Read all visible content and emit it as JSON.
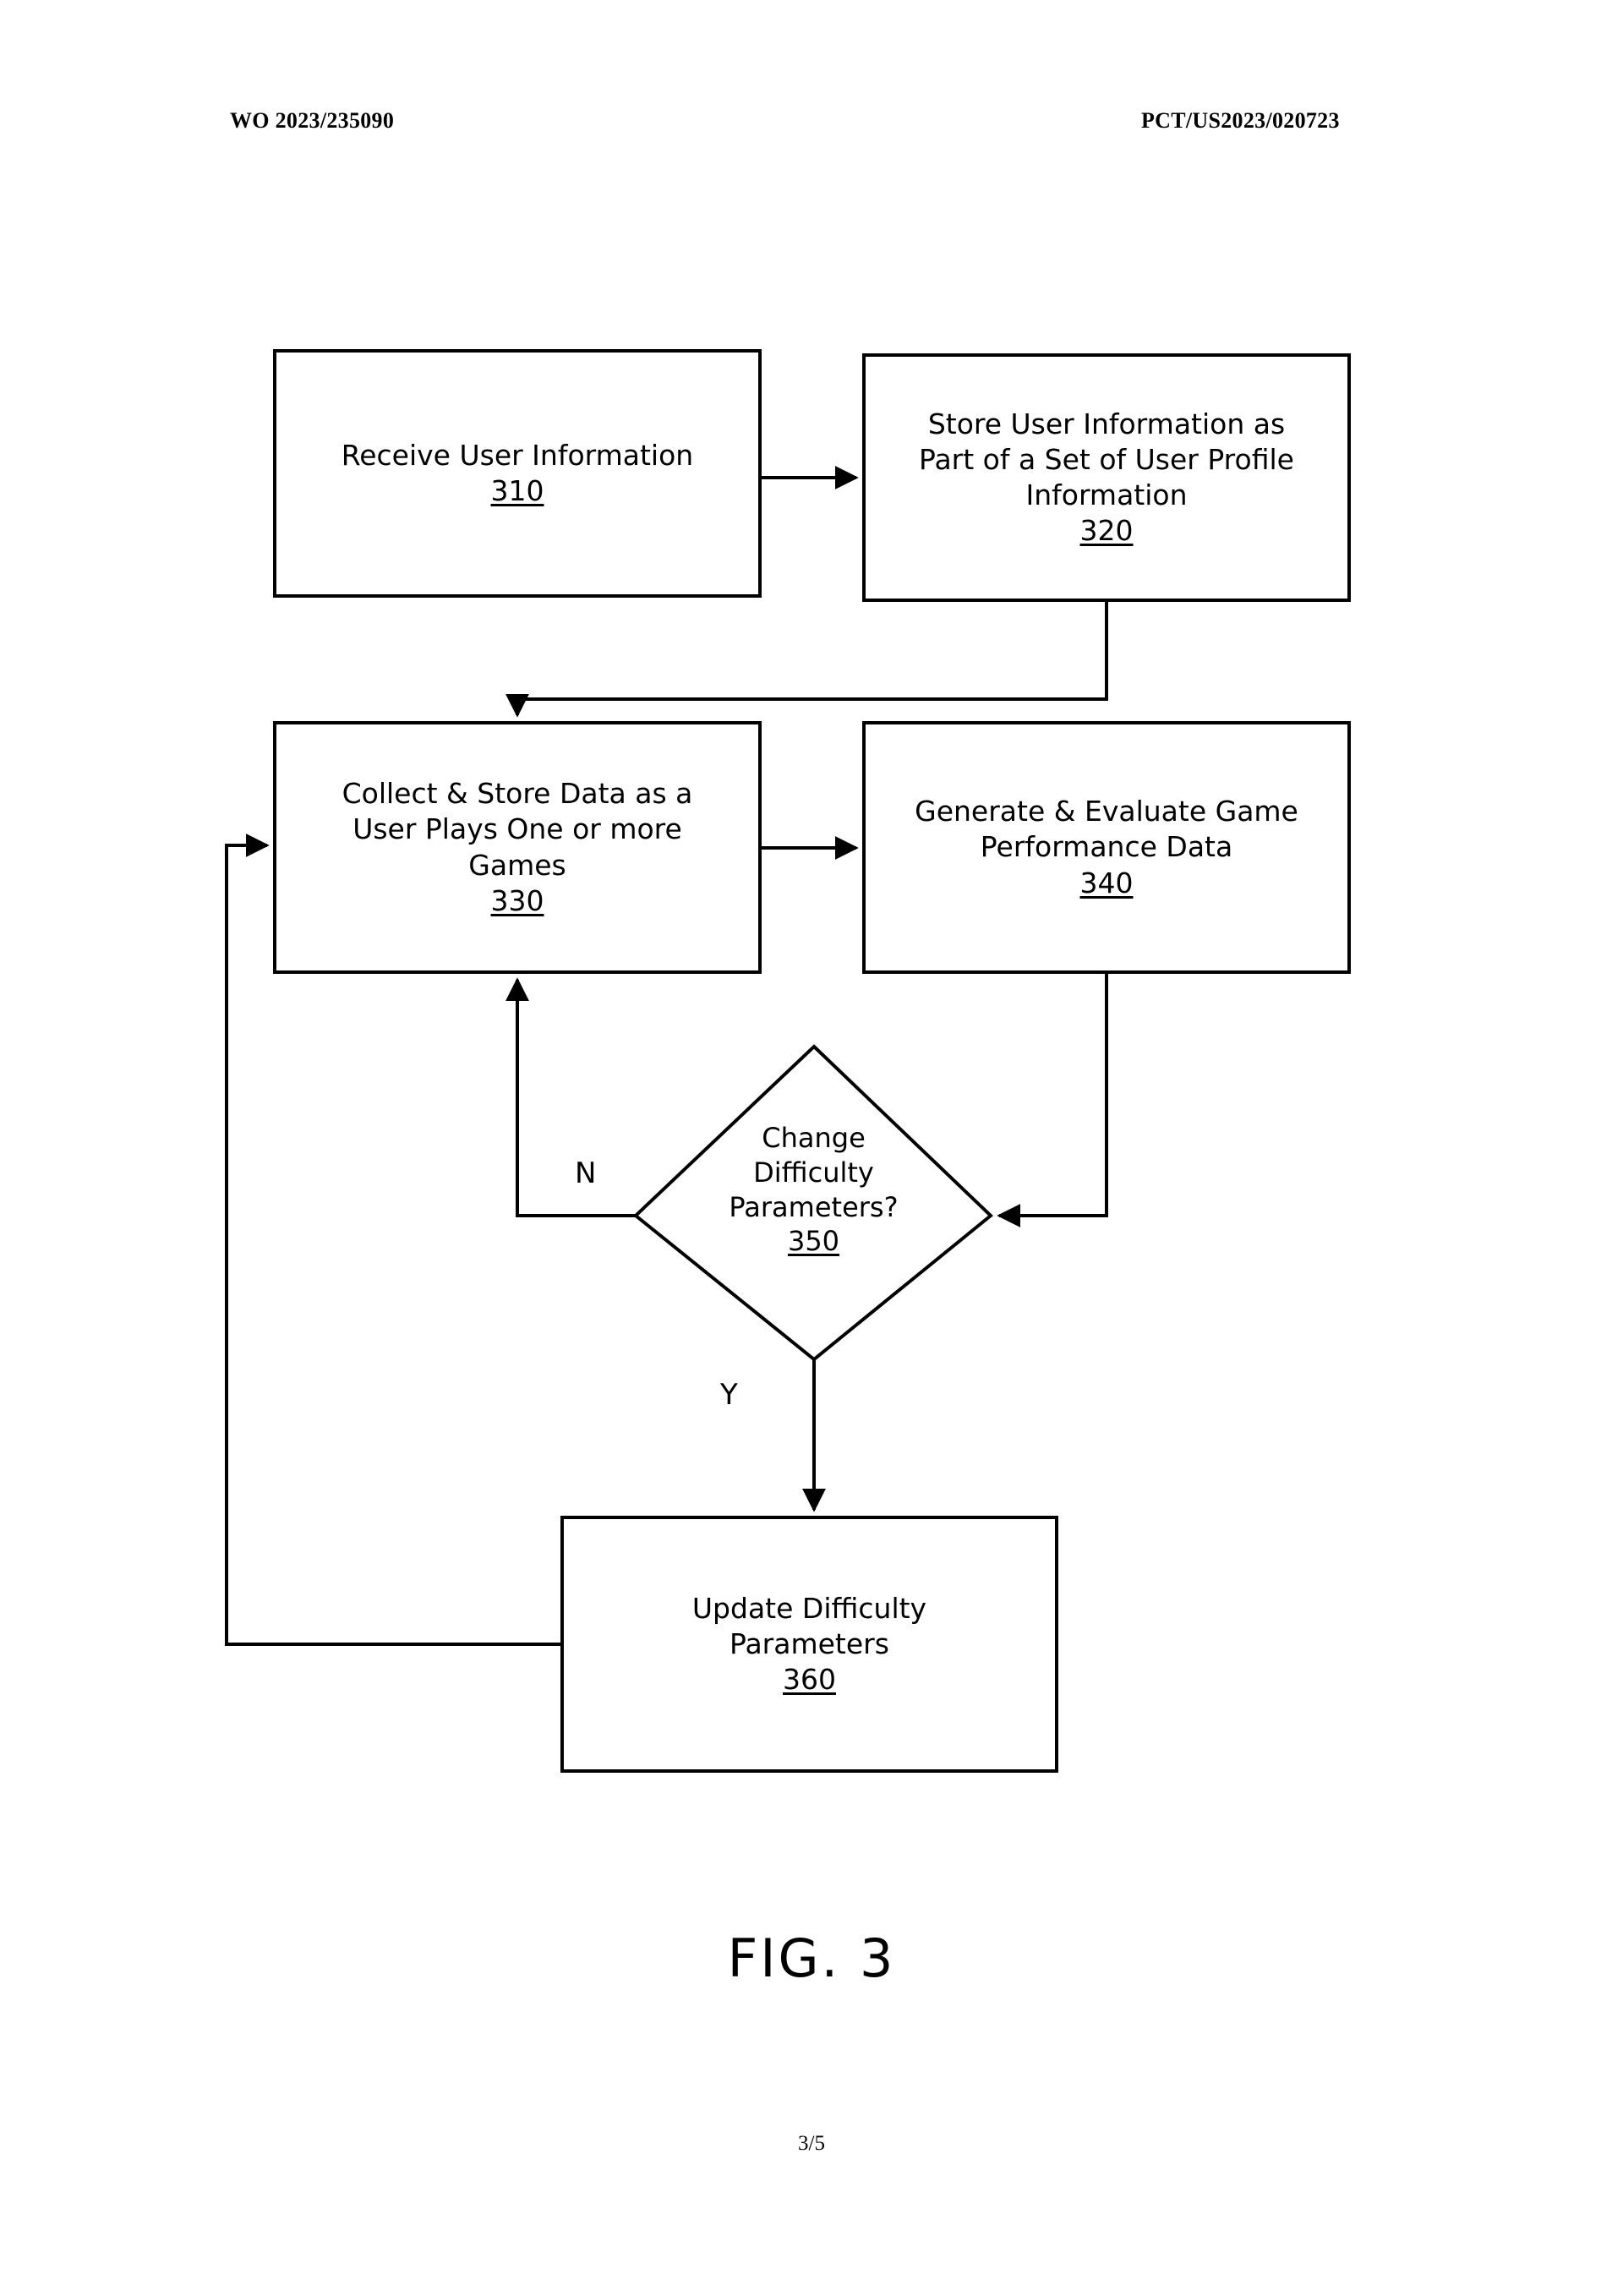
{
  "header": {
    "left": "WO 2023/235090",
    "right": "PCT/US2023/020723"
  },
  "figure": {
    "caption": "FIG. 3",
    "page_number": "3/5"
  },
  "chart_data": {
    "type": "diagram",
    "title": "FIG. 3",
    "nodes": [
      {
        "id": "310",
        "shape": "process",
        "label": "Receive User Information",
        "ref": "310",
        "lines": [
          "Receive User Information"
        ]
      },
      {
        "id": "320",
        "shape": "process",
        "label": "Store User Information as Part of a Set of User Profile Information",
        "ref": "320",
        "lines": [
          "Store User Information as",
          "Part of a Set of User Profile",
          "Information"
        ]
      },
      {
        "id": "330",
        "shape": "process",
        "label": "Collect & Store Data as a User Plays One or more Games",
        "ref": "330",
        "lines": [
          "Collect & Store Data as a",
          "User Plays One or more",
          "Games"
        ]
      },
      {
        "id": "340",
        "shape": "process",
        "label": "Generate & Evaluate Game Performance Data",
        "ref": "340",
        "lines": [
          "Generate & Evaluate Game",
          "Performance Data"
        ]
      },
      {
        "id": "350",
        "shape": "decision",
        "label": "Change Difficulty Parameters?",
        "ref": "350",
        "lines": [
          "Change",
          "Difficulty",
          "Parameters?"
        ]
      },
      {
        "id": "360",
        "shape": "process",
        "label": "Update Difficulty Parameters",
        "ref": "360",
        "lines": [
          "Update Difficulty",
          "Parameters"
        ]
      }
    ],
    "edges": [
      {
        "from": "310",
        "to": "320",
        "label": ""
      },
      {
        "from": "320",
        "to": "330",
        "label": ""
      },
      {
        "from": "330",
        "to": "340",
        "label": ""
      },
      {
        "from": "340",
        "to": "350",
        "label": ""
      },
      {
        "from": "350",
        "to": "330",
        "label": "N"
      },
      {
        "from": "350",
        "to": "360",
        "label": "Y"
      },
      {
        "from": "360",
        "to": "330",
        "label": ""
      }
    ],
    "branch_labels": {
      "no": "N",
      "yes": "Y"
    },
    "stroke_color": "#000000",
    "fill_color": "#ffffff"
  },
  "nodes": {
    "n310": {
      "l1": "Receive User Information",
      "ref": "310"
    },
    "n320": {
      "l1": "Store User Information as",
      "l2": "Part of a Set of User Profile",
      "l3": "Information",
      "ref": "320"
    },
    "n330": {
      "l1": "Collect & Store Data as a",
      "l2": "User Plays One or more",
      "l3": "Games",
      "ref": "330"
    },
    "n340": {
      "l1": "Generate & Evaluate Game",
      "l2": "Performance Data",
      "ref": "340"
    },
    "n350": {
      "l1": "Change",
      "l2": "Difficulty",
      "l3": "Parameters?",
      "ref": "350"
    },
    "n360": {
      "l1": "Update Difficulty",
      "l2": "Parameters",
      "ref": "360"
    }
  },
  "labels": {
    "no": "N",
    "yes": "Y"
  }
}
